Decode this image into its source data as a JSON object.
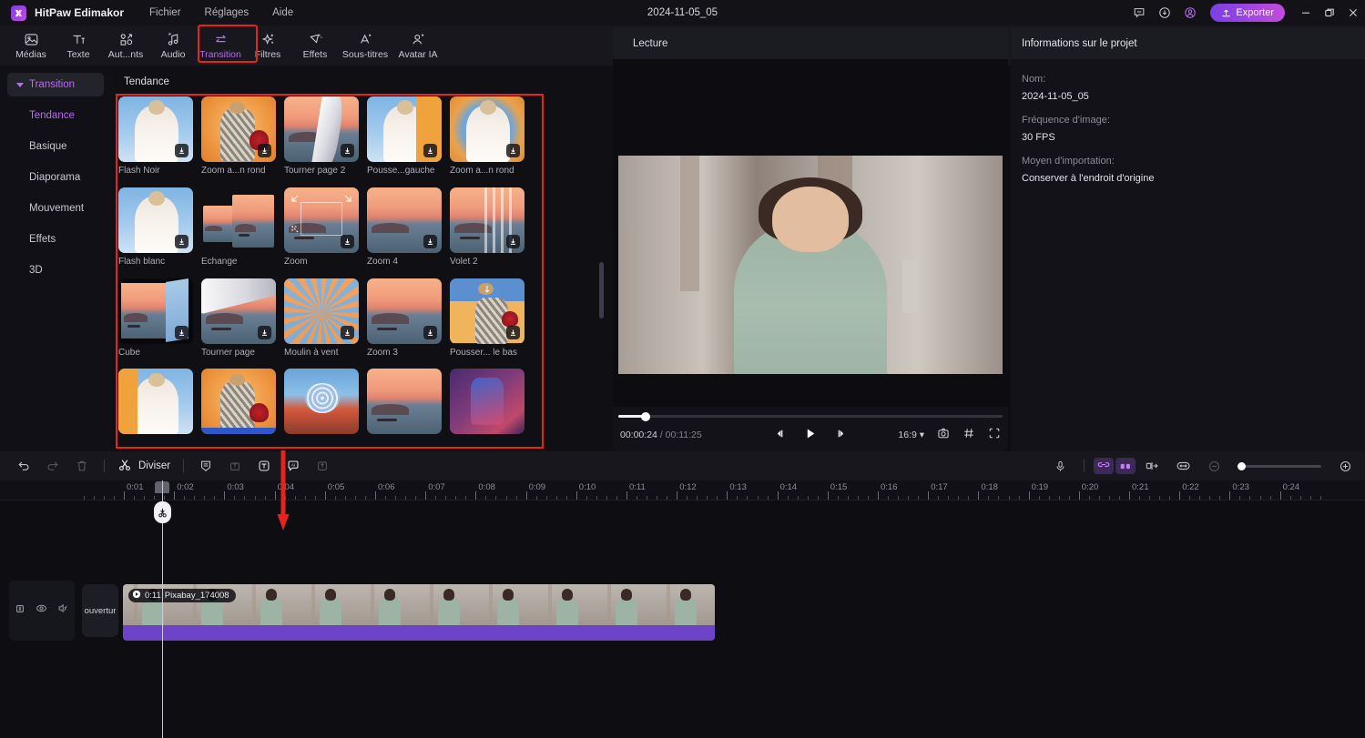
{
  "titlebar": {
    "app_name": "HitPaw Edimakor",
    "document_title": "2024-11-05_05",
    "menus": [
      "Fichier",
      "Réglages",
      "Aide"
    ],
    "export_label": "Exporter",
    "icons": [
      "feedback-icon",
      "download-icon",
      "account-icon"
    ],
    "window_controls": [
      "minimize",
      "restore",
      "close"
    ],
    "accent": "#b96cf0"
  },
  "toolbar": {
    "items": [
      {
        "label": "Médias",
        "icon": "media-icon",
        "active": false
      },
      {
        "label": "Texte",
        "icon": "text-icon",
        "active": false
      },
      {
        "label": "Aut...nts",
        "icon": "elements-icon",
        "active": false
      },
      {
        "label": "Audio",
        "icon": "audio-icon",
        "active": false
      },
      {
        "label": "Transition",
        "icon": "transition-icon",
        "active": true
      },
      {
        "label": "Filtres",
        "icon": "filters-icon",
        "active": false
      },
      {
        "label": "Effets",
        "icon": "effects-icon",
        "active": false
      },
      {
        "label": "Sous-titres",
        "icon": "subtitles-icon",
        "active": false
      },
      {
        "label": "Avatar IA",
        "icon": "ai-avatar-icon",
        "active": false
      }
    ],
    "highlight_color": "#e8231c"
  },
  "sidebar": {
    "header": "Transition",
    "items": [
      {
        "label": "Tendance",
        "selected": true
      },
      {
        "label": "Basique",
        "selected": false
      },
      {
        "label": "Diaporama",
        "selected": false
      },
      {
        "label": "Mouvement",
        "selected": false
      },
      {
        "label": "Effets",
        "selected": false
      },
      {
        "label": "3D",
        "selected": false
      }
    ]
  },
  "browser": {
    "section_title": "Tendance",
    "items": [
      {
        "label": "Flash Noir",
        "art": "girl-blue",
        "download": true
      },
      {
        "label": "Zoom a...n rond",
        "art": "man-orange",
        "download": true
      },
      {
        "label": "Tourner page 2",
        "art": "page-curl",
        "download": true
      },
      {
        "label": "Pousse...gauche",
        "art": "girl-push-right",
        "download": true
      },
      {
        "label": "Zoom a...n rond",
        "art": "girl-circle",
        "download": true
      },
      {
        "label": "Flash blanc",
        "art": "girl-white",
        "download": true
      },
      {
        "label": "Echange",
        "art": "exchange",
        "download": false
      },
      {
        "label": "Zoom",
        "art": "zoom-frame",
        "download": true
      },
      {
        "label": "Zoom 4",
        "art": "sunset-plain",
        "download": true
      },
      {
        "label": "Volet 2",
        "art": "vertical-bars",
        "download": true
      },
      {
        "label": "Cube",
        "art": "cube",
        "download": true
      },
      {
        "label": "Tourner page",
        "art": "page-turn",
        "download": true
      },
      {
        "label": "Moulin à vent",
        "art": "windmill",
        "download": true
      },
      {
        "label": "Zoom 3",
        "art": "sunset-plain",
        "download": true
      },
      {
        "label": "Pousser... le bas",
        "art": "push-down",
        "download": true
      },
      {
        "label": "",
        "art": "girl-push-left",
        "download": false
      },
      {
        "label": "",
        "art": "man-orange2",
        "download": false
      },
      {
        "label": "",
        "art": "swirl",
        "download": false
      },
      {
        "label": "",
        "art": "sunset-plain2",
        "download": false
      },
      {
        "label": "",
        "art": "purple-guitar",
        "download": false
      }
    ]
  },
  "preview": {
    "header": "Lecture",
    "current_time": "00:00:24",
    "total_time": "00:11:25",
    "separator": "/",
    "aspect_ratio": "16:9",
    "controls": [
      "prev-frame-icon",
      "play-icon",
      "next-frame-icon"
    ],
    "right_icons": [
      "snapshot-icon",
      "grid-icon",
      "fullscreen-icon"
    ]
  },
  "inspector": {
    "header": "Informations sur le projet",
    "fields": [
      {
        "label": "Nom:",
        "value": "2024-11-05_05"
      },
      {
        "label": "Fréquence d'image:",
        "value": "30 FPS"
      },
      {
        "label": "Moyen d'importation:",
        "value": "Conserver à l'endroit d'origine"
      }
    ]
  },
  "timeline_toolbar": {
    "left_icons": [
      "undo-icon",
      "redo-icon",
      "delete-icon"
    ],
    "split_label": "Diviser",
    "split_icon": "scissors-icon",
    "mid_icons": [
      "crop-icon",
      "export-frame-icon",
      "text-template-icon",
      "ai-caption-icon",
      "upload-icon"
    ],
    "right_icons": [
      "microphone-icon",
      "link-clips-icon",
      "group-icon",
      "detach-audio-icon",
      "fit-timeline-icon"
    ],
    "zoom_out_icon": "zoom-out-icon",
    "zoom_in_icon": "zoom-in-icon",
    "zoom_value": "0"
  },
  "ruler": {
    "labels": [
      "0:01",
      "0:02",
      "0:03",
      "0:04",
      "0:05",
      "0:06",
      "0:07",
      "0:08",
      "0:09",
      "0:10",
      "0:11",
      "0:12",
      "0:13",
      "0:14",
      "0:15",
      "0:16",
      "0:17",
      "0:18",
      "0:19",
      "0:20",
      "0:21",
      "0:22",
      "0:23",
      "0:24"
    ]
  },
  "timeline": {
    "track_header_icons": [
      "lock-icon",
      "eye-icon",
      "mute-icon"
    ],
    "opening_clip_label": "ouvertur",
    "clip": {
      "duration": "0:11",
      "name": "Pixabay_174008",
      "icon": "video-icon",
      "audio_color": "#6d43c8"
    },
    "playhead_position": "0:01"
  },
  "annotations": {
    "arrow_color": "#e8231c",
    "boxes": [
      "transition-tool-highlight",
      "transition-grid-highlight"
    ]
  }
}
